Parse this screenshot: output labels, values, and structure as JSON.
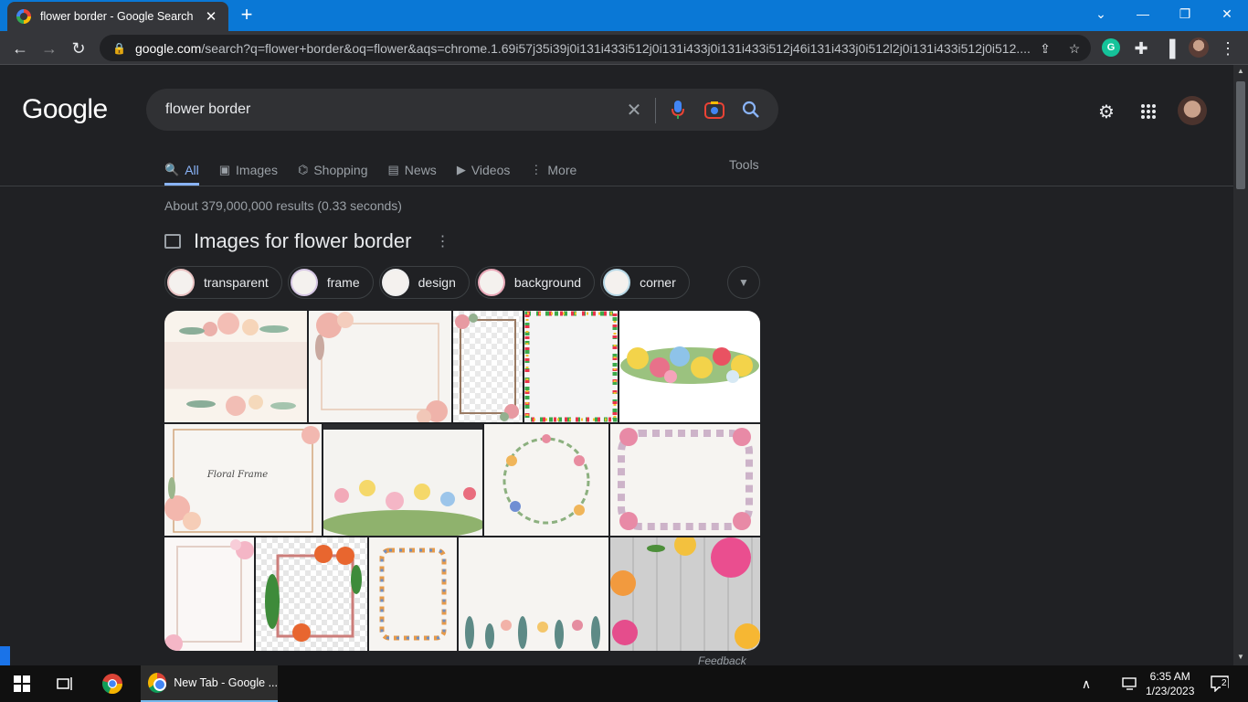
{
  "browser": {
    "tab_title": "flower border - Google Search",
    "url_host": "google.com",
    "url_path": "/search?q=flower+border&oq=flower&aqs=chrome.1.69i57j35i39j0i131i433i512j0i131i433j0i131i433i512j46i131i433j0i512l2j0i131i433i512j0i512....",
    "new_tab_label": "+",
    "grammarly_label": "G"
  },
  "search": {
    "logo": "Google",
    "query": "flower border",
    "tabs": [
      {
        "label": "All",
        "icon": "search-icon"
      },
      {
        "label": "Images",
        "icon": "image-icon"
      },
      {
        "label": "Shopping",
        "icon": "tag-icon"
      },
      {
        "label": "News",
        "icon": "news-icon"
      },
      {
        "label": "Videos",
        "icon": "play-icon"
      },
      {
        "label": "More",
        "icon": "more-vert-icon"
      }
    ],
    "tools_label": "Tools",
    "stats": "About 379,000,000 results (0.33 seconds)"
  },
  "images_section": {
    "title": "Images for flower border",
    "chips": [
      "transparent",
      "frame",
      "design",
      "background",
      "corner"
    ],
    "feedback": "Feedback"
  },
  "taskbar": {
    "app_label": "New Tab - Google ...",
    "time": "6:35 AM",
    "date": "1/23/2023",
    "notification_count": "2"
  }
}
